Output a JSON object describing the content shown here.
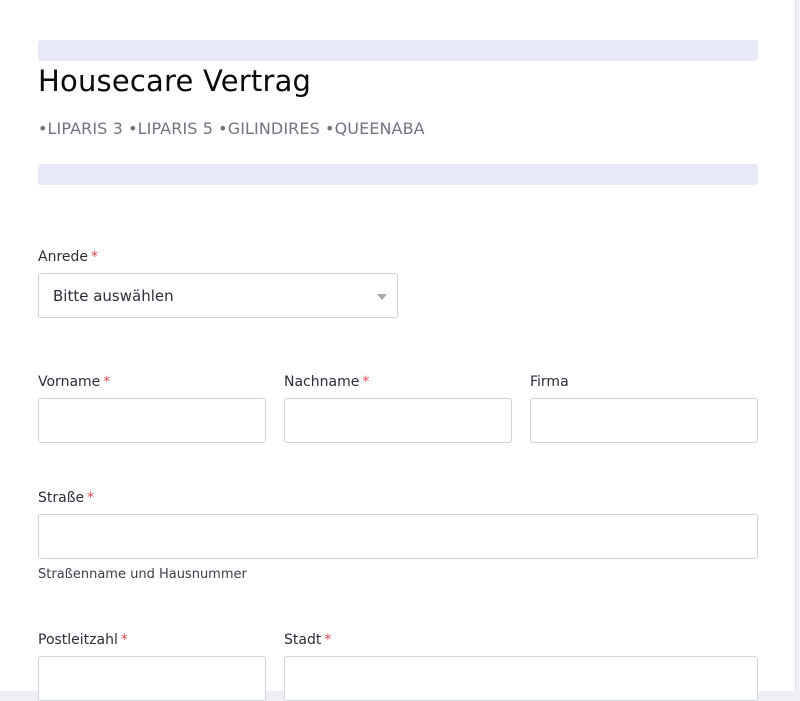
{
  "form": {
    "title": "Housecare Vertrag",
    "subtitle": "•LIPARIS 3 •LIPARIS 5 •GILINDIRES •QUEENABA",
    "required_marker": "*"
  },
  "fields": {
    "salutation": {
      "label": "Anrede",
      "value": "Bitte auswählen"
    },
    "first_name": {
      "label": "Vorname"
    },
    "last_name": {
      "label": "Nachname"
    },
    "company": {
      "label": "Firma"
    },
    "street": {
      "label": "Straße",
      "sublabel": "Straßenname und Hausnummer"
    },
    "postal_code": {
      "label": "Postleitzahl"
    },
    "city": {
      "label": "Stadt"
    }
  },
  "colors": {
    "divider": "#e8e9f9",
    "required": "#e0484f",
    "border": "#cfd3dc"
  },
  "icons": {
    "dropdown": "caret-down-icon"
  }
}
